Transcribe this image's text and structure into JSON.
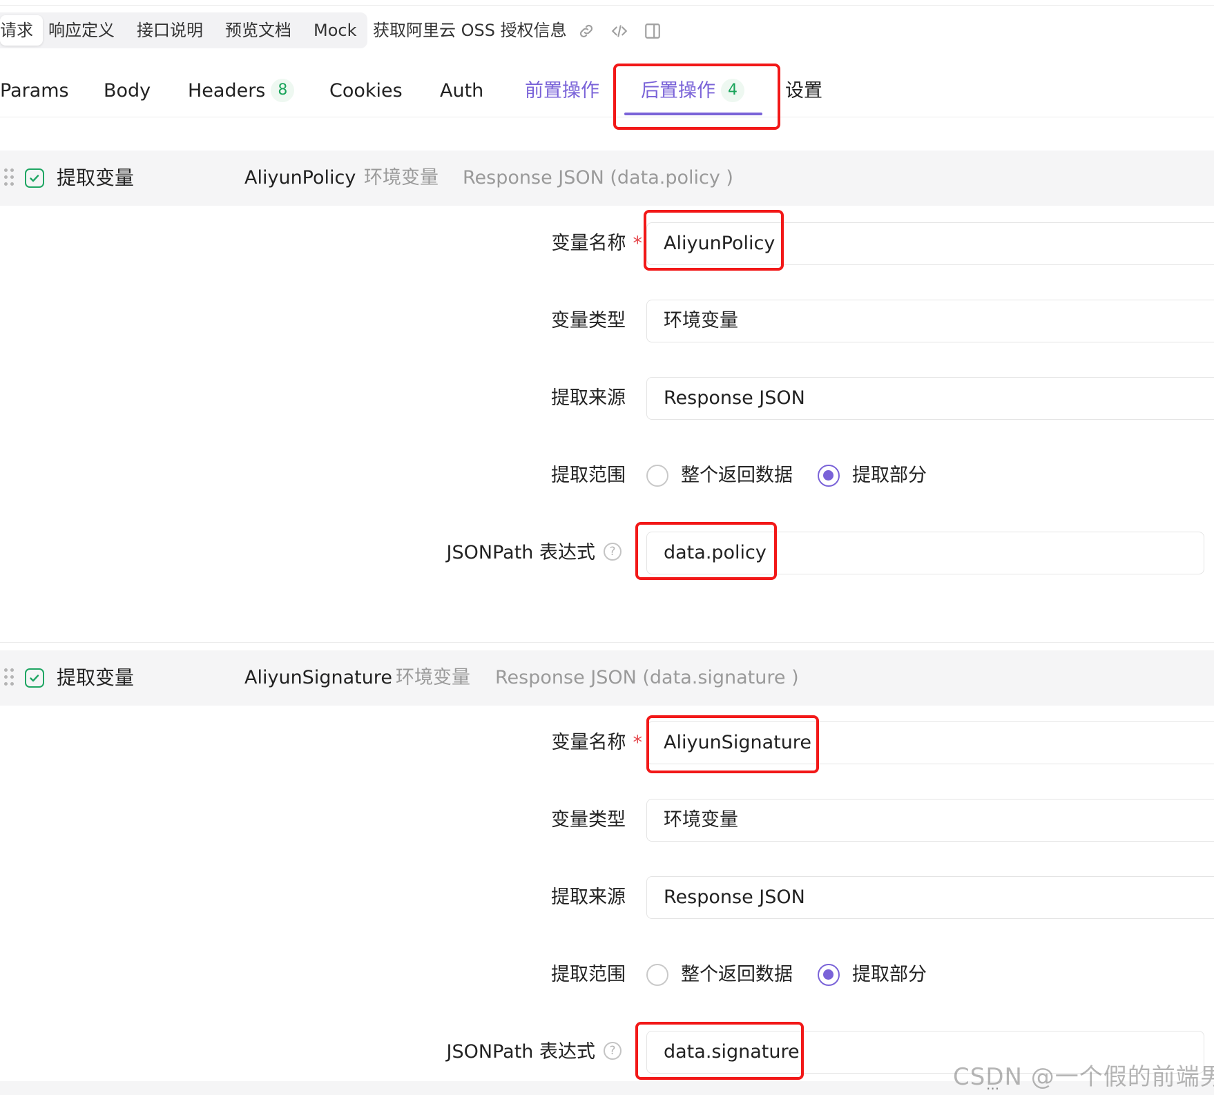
{
  "top_tabs": {
    "items": [
      "请求",
      "响应定义",
      "接口说明",
      "预览文档",
      "Mock"
    ],
    "active_index": 0,
    "request_title": "获取阿里云 OSS 授权信息",
    "icons": [
      "link-icon",
      "code-icon",
      "panel-toggle-icon"
    ]
  },
  "sub_tabs": {
    "params": "Params",
    "body": "Body",
    "headers": "Headers",
    "headers_badge": "8",
    "cookies": "Cookies",
    "auth": "Auth",
    "pre_ops": "前置操作",
    "post_ops": "后置操作",
    "post_ops_badge": "4",
    "settings": "设置",
    "active": "后置操作"
  },
  "labels": {
    "var_name": "变量名称",
    "required": "*",
    "var_type": "变量类型",
    "source": "提取来源",
    "scope": "提取范围",
    "jsonpath": "JSONPath 表达式",
    "help": "?"
  },
  "extractions": [
    {
      "title": "提取变量",
      "enabled": true,
      "summary_name": "AliyunPolicy",
      "summary_type": "环境变量",
      "summary_source": "Response JSON (data.policy )",
      "var_name": "AliyunPolicy",
      "var_type": "环境变量",
      "source": "Response JSON",
      "scope_options": [
        "整个返回数据",
        "提取部分"
      ],
      "scope_selected": "提取部分",
      "jsonpath": "data.policy"
    },
    {
      "title": "提取变量",
      "enabled": true,
      "summary_name": "AliyunSignature",
      "summary_type": "环境变量",
      "summary_source": "Response JSON (data.signature )",
      "var_name": "AliyunSignature",
      "var_type": "环境变量",
      "source": "Response JSON",
      "scope_options": [
        "整个返回数据",
        "提取部分"
      ],
      "scope_selected": "提取部分",
      "jsonpath": "data.signature"
    }
  ],
  "watermark": "CSDN @一个假的前端男",
  "colors": {
    "accent": "#7a63d8",
    "highlight": "#f21818",
    "success": "#1fa663",
    "badge_text": "#19a45a",
    "required": "#e5484d"
  }
}
